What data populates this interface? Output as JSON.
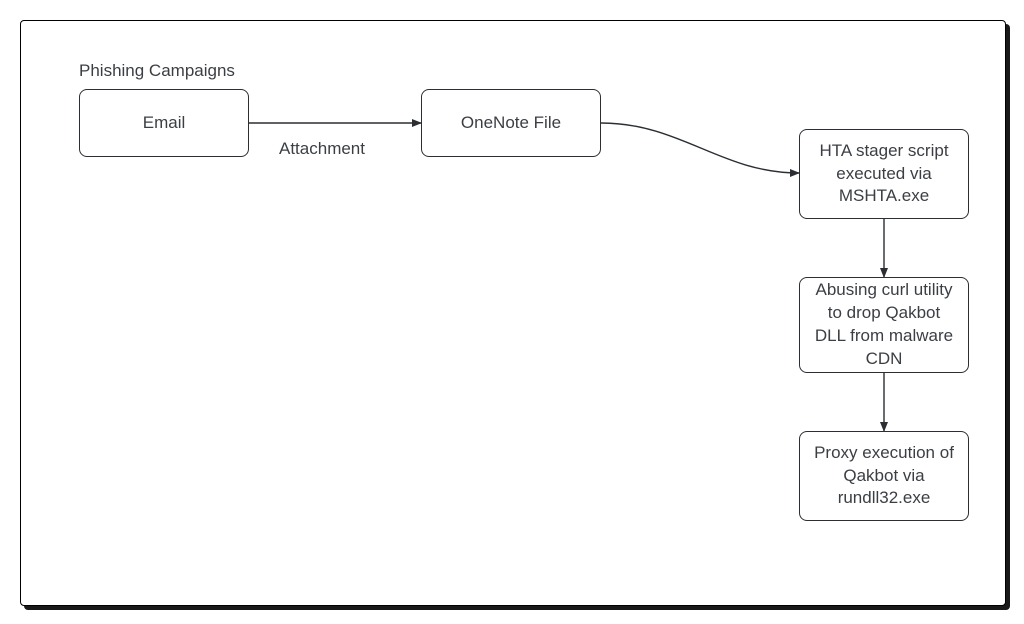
{
  "diagram": {
    "title": "Phishing Campaigns",
    "nodes": {
      "email": "Email",
      "onenote": "OneNote File",
      "hta": "HTA stager script executed via MSHTA.exe",
      "curl": "Abusing curl utility to drop Qakbot DLL from malware CDN",
      "rundll": "Proxy execution of Qakbot via rundll32.exe"
    },
    "edges": {
      "attachment": "Attachment"
    }
  }
}
